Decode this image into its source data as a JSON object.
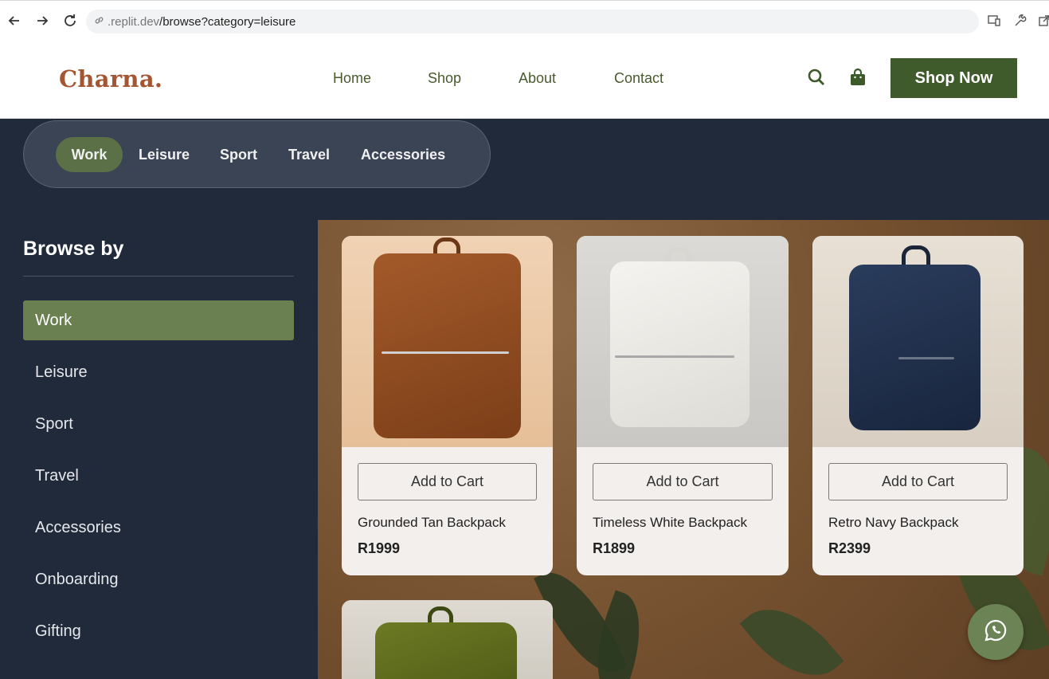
{
  "browser": {
    "url_host": ".replit.dev",
    "url_path": "/browse?category=leisure"
  },
  "header": {
    "logo": "Charna.",
    "nav": [
      "Home",
      "Shop",
      "About",
      "Contact"
    ],
    "cta": "Shop Now",
    "accent": "#3f5a2b",
    "logo_color": "#a45532"
  },
  "category_pills": {
    "items": [
      "Work",
      "Leisure",
      "Sport",
      "Travel",
      "Accessories"
    ],
    "active": "Work"
  },
  "sidebar": {
    "title": "Browse by",
    "items": [
      "Work",
      "Leisure",
      "Sport",
      "Travel",
      "Accessories",
      "Onboarding",
      "Gifting"
    ],
    "active": "Work"
  },
  "products": [
    {
      "name": "Grounded Tan Backpack",
      "price": "R1999",
      "button": "Add to Cart",
      "color": "#8a4a22"
    },
    {
      "name": "Timeless White Backpack",
      "price": "R1899",
      "button": "Add to Cart",
      "color": "#ecebe6"
    },
    {
      "name": "Retro Navy Backpack",
      "price": "R2399",
      "button": "Add to Cart",
      "color": "#1e2e4a"
    },
    {
      "color": "#5e6a1e"
    }
  ],
  "icons": {
    "back": "arrow-left-icon",
    "forward": "arrow-right-icon",
    "reload": "reload-icon",
    "search": "search-icon",
    "cart": "shopping-bag-icon",
    "whatsapp": "whatsapp-icon"
  }
}
